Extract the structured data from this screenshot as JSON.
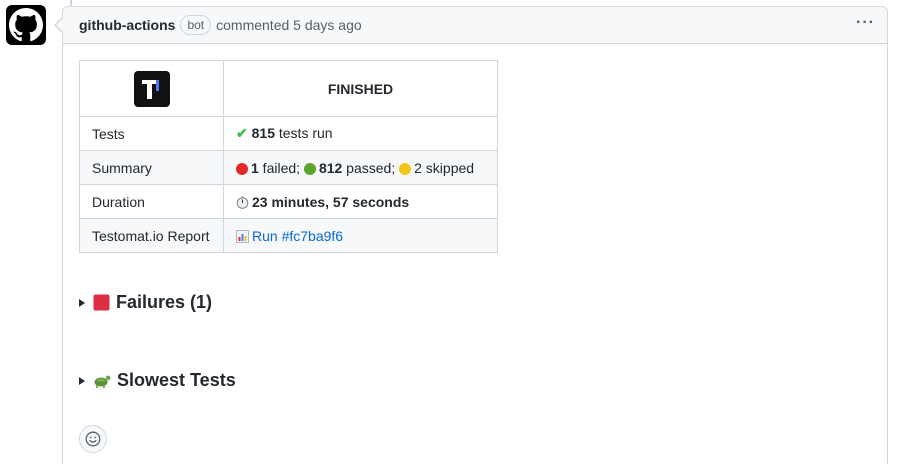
{
  "comment": {
    "author": "github-actions",
    "badge": "bot",
    "meta": "commented 5 days ago",
    "menu_glyph": "···"
  },
  "report": {
    "header_status": "FINISHED",
    "rows": [
      {
        "label": "Tests",
        "count": "815",
        "text": " tests run"
      },
      {
        "label": "Summary",
        "failed_count": "1",
        "failed_text": " failed;",
        "passed_count": "812",
        "passed_text": " passed;",
        "skipped_text": "2 skipped"
      },
      {
        "label": "Duration",
        "value": "23 minutes, 57 seconds"
      },
      {
        "label": "Testomat.io Report",
        "link": "Run #fc7ba9f6"
      }
    ]
  },
  "sections": [
    {
      "label": "Failures (1)",
      "icon": "red-square-icon"
    },
    {
      "label": "Slowest Tests",
      "icon": "turtle-icon"
    }
  ],
  "icons": {
    "avatar": "github-octocat-icon",
    "logo": "testomatio-logo",
    "check": "check-mark-icon",
    "clock": "stopwatch-icon",
    "chart": "bar-chart-icon",
    "reaction": "smiley-icon"
  },
  "colors": {
    "link": "#0969da",
    "border": "#d0d7de",
    "header_bg": "#f6f8fa",
    "failed": "#e5282a",
    "passed": "#5ba52c",
    "skipped": "#f5c518"
  }
}
